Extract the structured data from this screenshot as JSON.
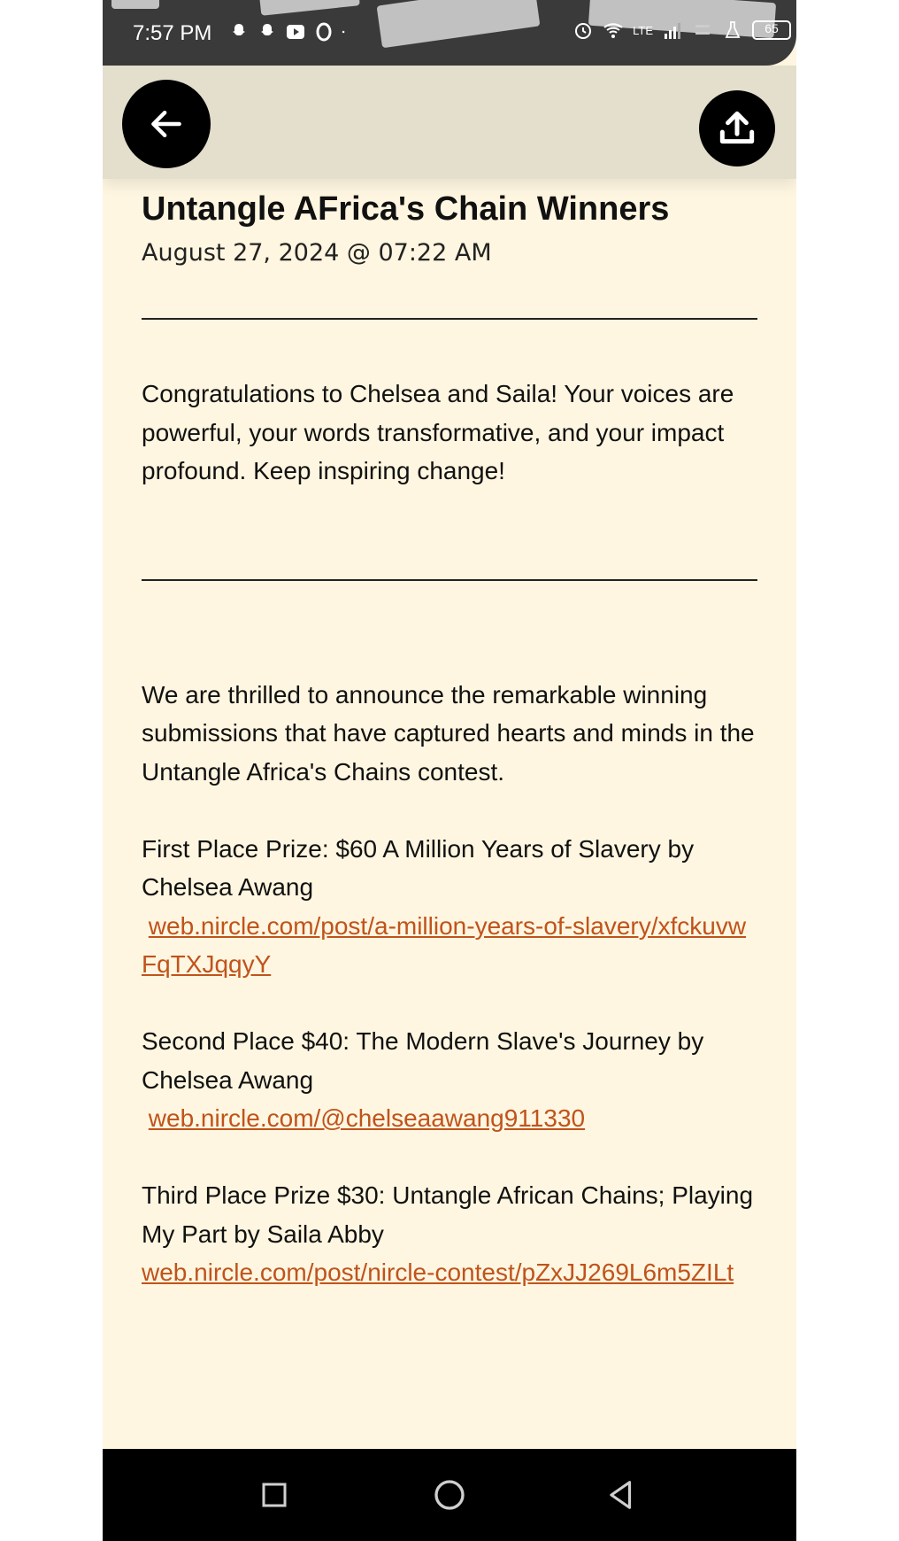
{
  "status_bar": {
    "time": "7:57 PM",
    "network_type": "LTE",
    "battery_level": "65",
    "icons": [
      "snapchat-icon",
      "snapchat-icon",
      "youtube-icon",
      "opera-icon",
      "dot-icon",
      "alarm-icon",
      "wifi-icon",
      "volte-icon",
      "signal-icon",
      "data-speed-icon",
      "lab-icon",
      "battery-icon"
    ]
  },
  "header": {
    "back_icon": "arrow-left-icon",
    "share_icon": "share-upload-icon"
  },
  "post": {
    "title": "Untangle AFrica's Chain Winners",
    "date": "August 27, 2024 @ 07:22 AM",
    "intro": "Congratulations to Chelsea and Saila! Your voices are powerful, your words transformative, and your impact profound. Keep inspiring change!",
    "announcement": "We are thrilled to announce the remarkable winning submissions that have captured hearts and minds in the Untangle Africa's Chains contest.",
    "prizes": [
      {
        "text": "First Place Prize: $60 A Million Years of Slavery by Chelsea Awang",
        "link": "web.nircle.com/post/a-million-years-of-slavery/xfckuvwFqTXJqqyY"
      },
      {
        "text": "Second Place $40: The Modern Slave's Journey by Chelsea Awang",
        "link": "web.nircle.com/@chelseaawang911330"
      },
      {
        "text": "Third Place Prize $30: Untangle African Chains; Playing My Part by Saila Abby",
        "link": "web.nircle.com/post/nircle-contest/pZxJJ269L6m5ZILt"
      }
    ],
    "link_color": "#c0531c"
  },
  "nav_bar": {
    "buttons": [
      "recents-square-icon",
      "home-circle-icon",
      "back-triangle-icon"
    ]
  }
}
